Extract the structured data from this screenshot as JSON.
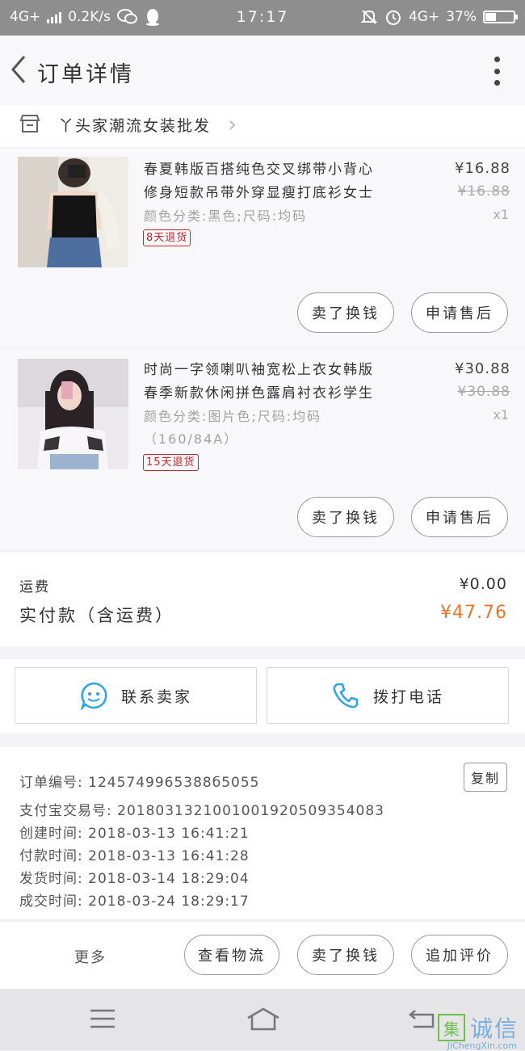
{
  "status_bar": {
    "network": "4G+",
    "speed": "0.2K/s",
    "time": "17:17",
    "network_right": "4G+",
    "battery": "37%",
    "battery_level": 0.37
  },
  "header": {
    "title": "订单详情"
  },
  "shop": {
    "name": "丫头家潮流女装批发"
  },
  "items": [
    {
      "title_line1": "春夏韩版百搭纯色交叉绑带小背心",
      "title_line2": "修身短款吊带外穿显瘦打底衫女士",
      "sku": "颜色分类:黑色;尺码:均码",
      "sku_line2": "",
      "return_badge": "8天退货",
      "price": "¥16.88",
      "original_price": "¥16.88",
      "quantity": "x1",
      "button_sell": "卖了换钱",
      "button_aftersale": "申请售后"
    },
    {
      "title_line1": "时尚一字领喇叭袖宽松上衣女韩版",
      "title_line2": "春季新款休闲拼色露肩衬衣衫学生",
      "sku": "颜色分类:图片色;尺码:均码",
      "sku_line2": "（160/84A）",
      "return_badge": "15天退货",
      "price": "¥30.88",
      "original_price": "¥30.88",
      "quantity": "x1",
      "button_sell": "卖了换钱",
      "button_aftersale": "申请售后"
    }
  ],
  "summary": {
    "shipping_label": "运费",
    "shipping_value": "¥0.00",
    "paid_label": "实付款（含运费）",
    "paid_value": "¥47.76"
  },
  "contact": {
    "seller_label": "联系卖家",
    "phone_label": "拨打电话"
  },
  "order_info": {
    "order_no": "订单编号: 1245749965388б5055",
    "alipay_no": "支付宝交易号: 2018031321001001920509354083",
    "created": "创建时间: 2018-03-13  16:41:21",
    "paid": "付款时间: 2018-03-13  16:41:28",
    "shipped": "发货时间: 2018-03-14  18:29:04",
    "completed": "成交时间: 2018-03-24  18:29:17",
    "copy_label": "复制"
  },
  "actions": {
    "more": "更多",
    "logistics": "查看物流",
    "sell": "卖了换钱",
    "review": "追加评价"
  },
  "watermark": {
    "char": "集",
    "text": "诚信",
    "url": "JiChengXin.com"
  }
}
